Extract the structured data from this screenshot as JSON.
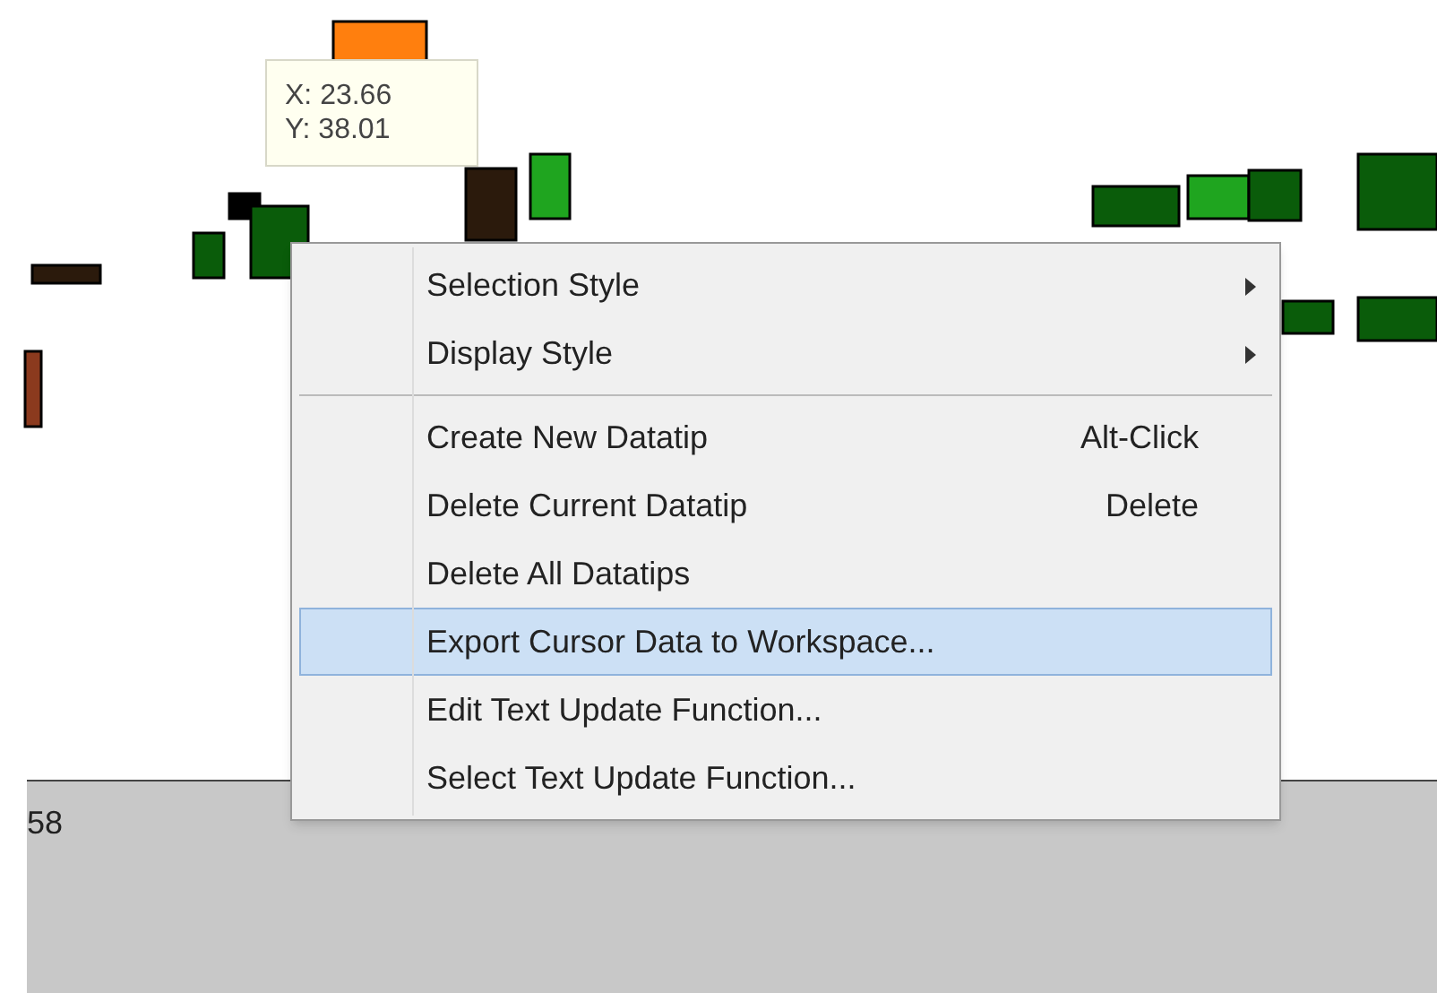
{
  "plot": {
    "tick_label": "58",
    "datatip": {
      "lines": [
        "X: 23.66",
        "Y: 38.01"
      ]
    }
  },
  "context_menu": {
    "items": [
      {
        "kind": "item",
        "label": "Selection Style",
        "submenu": true,
        "selected": false
      },
      {
        "kind": "item",
        "label": "Display Style",
        "submenu": true,
        "selected": false
      },
      {
        "kind": "separator"
      },
      {
        "kind": "item",
        "label": "Create New Datatip",
        "shortcut": "Alt-Click",
        "submenu": false,
        "selected": false
      },
      {
        "kind": "item",
        "label": "Delete Current Datatip",
        "shortcut": "Delete",
        "submenu": false,
        "selected": false
      },
      {
        "kind": "item",
        "label": "Delete All Datatips",
        "submenu": false,
        "selected": false
      },
      {
        "kind": "item",
        "label": "Export Cursor Data to Workspace...",
        "submenu": false,
        "selected": true
      },
      {
        "kind": "item",
        "label": "Edit Text Update Function...",
        "submenu": false,
        "selected": false
      },
      {
        "kind": "item",
        "label": "Select Text Update Function...",
        "submenu": false,
        "selected": false
      }
    ]
  }
}
